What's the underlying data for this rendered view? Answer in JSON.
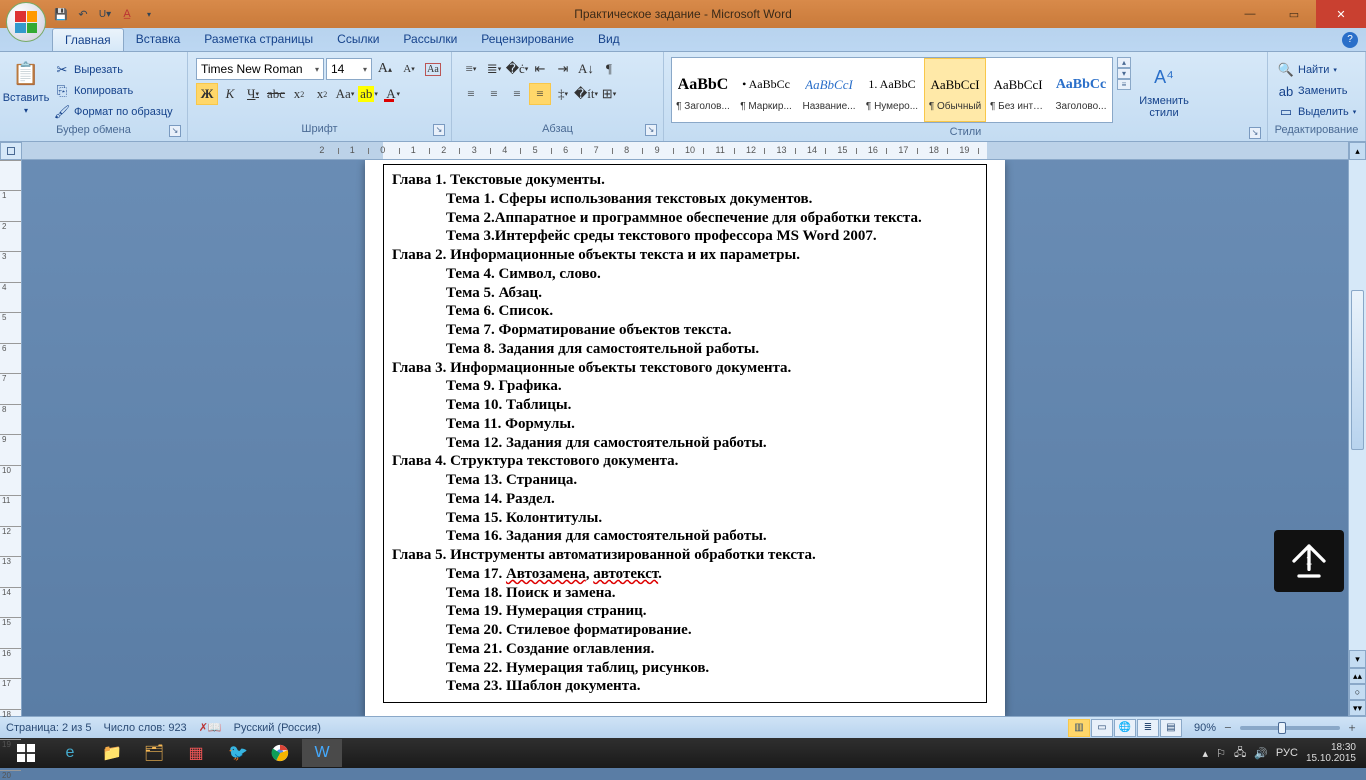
{
  "title": "Практическое задание - Microsoft Word",
  "qat": {
    "save": "💾",
    "undo": "↶",
    "redo": "↷",
    "checkmark": "✔"
  },
  "tabs": [
    "Главная",
    "Вставка",
    "Разметка страницы",
    "Ссылки",
    "Рассылки",
    "Рецензирование",
    "Вид"
  ],
  "active_tab_index": 0,
  "ribbon": {
    "clipboard": {
      "label": "Буфер обмена",
      "paste": "Вставить",
      "cut": "Вырезать",
      "copy": "Копировать",
      "format_painter": "Формат по образцу"
    },
    "font": {
      "label": "Шрифт",
      "family": "Times New Roman",
      "size": "14"
    },
    "paragraph": {
      "label": "Абзац"
    },
    "styles": {
      "label": "Стили",
      "items": [
        {
          "preview": "AaBbC",
          "name": "¶ Заголов...",
          "bold": true,
          "size": "16px",
          "italic": false
        },
        {
          "preview": "• AaBbCc",
          "name": "¶ Маркир...",
          "bold": false,
          "size": "12px",
          "italic": false
        },
        {
          "preview": "AaBbCcI",
          "name": "Название...",
          "bold": false,
          "size": "13px",
          "italic": true,
          "color": "#2a6fc9"
        },
        {
          "preview": "1. AaBbC",
          "name": "¶ Нумеро...",
          "bold": false,
          "size": "12px",
          "italic": false
        },
        {
          "preview": "AaBbCcI",
          "name": "¶ Обычный",
          "bold": false,
          "size": "13px",
          "italic": false,
          "selected": true
        },
        {
          "preview": "AaBbCcI",
          "name": "¶ Без инте...",
          "bold": false,
          "size": "13px",
          "italic": false
        },
        {
          "preview": "АаBbCc",
          "name": "Заголово...",
          "bold": true,
          "size": "14px",
          "italic": false,
          "color": "#2a6fc9"
        }
      ],
      "change": "Изменить\nстили"
    },
    "editing": {
      "label": "Редактирование",
      "find": "Найти",
      "replace": "Заменить",
      "select": "Выделить"
    }
  },
  "document": {
    "lines": [
      {
        "cls": "ch",
        "text": "Глава 1. Текстовые документы."
      },
      {
        "cls": "tp",
        "text": "Тема 1. Сферы использования текстовых документов."
      },
      {
        "cls": "tp",
        "text": "Тема 2.Аппаратное и программное обеспечение для обработки текста."
      },
      {
        "cls": "tp",
        "text": "Тема 3.Интерфейс среды текстового профессора MS Word 2007."
      },
      {
        "cls": "ch",
        "text": "Глава 2. Информационные объекты текста и их параметры."
      },
      {
        "cls": "tp",
        "text": "Тема 4. Символ, слово."
      },
      {
        "cls": "tp",
        "text": "Тема 5. Абзац."
      },
      {
        "cls": "tp",
        "text": "Тема 6. Список."
      },
      {
        "cls": "tp",
        "text": "Тема 7. Форматирование объектов текста."
      },
      {
        "cls": "tp",
        "text": "Тема 8. Задания для самостоятельной работы."
      },
      {
        "cls": "ch",
        "text": "Глава 3. Информационные объекты текстового документа."
      },
      {
        "cls": "tp",
        "text": "Тема 9. Графика."
      },
      {
        "cls": "tp",
        "text": "Тема 10. Таблицы."
      },
      {
        "cls": "tp",
        "text": "Тема 11. Формулы."
      },
      {
        "cls": "tp",
        "text": "Тема 12.  Задания для самостоятельной работы."
      },
      {
        "cls": "ch",
        "text": "Глава 4. Структура текстового документа."
      },
      {
        "cls": "tp",
        "text": "Тема 13. Страница."
      },
      {
        "cls": "tp",
        "text": "Тема 14. Раздел."
      },
      {
        "cls": "tp",
        "text": "Тема 15. Колонтитулы."
      },
      {
        "cls": "tp",
        "text": "Тема 16. Задания для самостоятельной работы."
      },
      {
        "cls": "ch",
        "text": "Глава 5. Инструменты автоматизированной обработки текста."
      },
      {
        "cls": "tp",
        "text": "Тема 17. ",
        "wavy": "Автозамена",
        "text2": ", ",
        "wavy3": "автотекст",
        "text3": "."
      },
      {
        "cls": "tp",
        "text": "Тема 18. Поиск и замена."
      },
      {
        "cls": "tp",
        "text": "Тема 19. Нумерация страниц."
      },
      {
        "cls": "tp",
        "text": "Тема 20. Стилевое форматирование."
      },
      {
        "cls": "tp",
        "text": "Тема 21. Создание оглавления."
      },
      {
        "cls": "tp",
        "text": "Тема 22. Нумерация таблиц, рисунков."
      },
      {
        "cls": "tp",
        "text": "Тема 23. Шаблон документа."
      }
    ]
  },
  "status": {
    "page": "Страница: 2 из 5",
    "words": "Число слов: 923",
    "lang": "Русский (Россия)",
    "zoom": "90%"
  },
  "taskbar": {
    "tray_lang": "РУС",
    "time": "18:30",
    "date": "15.10.2015"
  }
}
